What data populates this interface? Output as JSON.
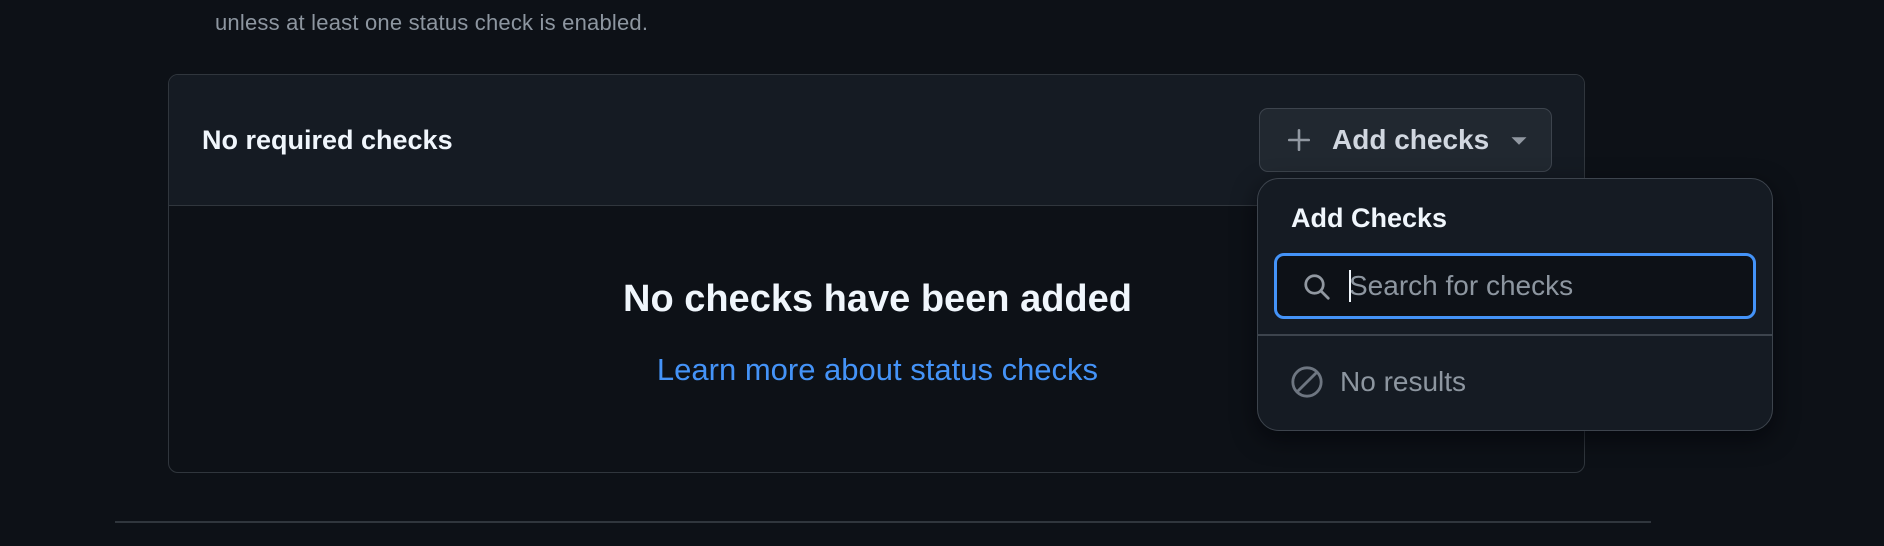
{
  "description": {
    "line": "unless at least one status check is enabled."
  },
  "checks_section": {
    "header_title": "No required checks",
    "add_button_label": "Add checks",
    "empty_title": "No checks have been added",
    "learn_more_link": "Learn more about status checks"
  },
  "dropdown": {
    "title": "Add Checks",
    "search_placeholder": "Search for checks",
    "search_value": "",
    "no_results_text": "No results"
  },
  "colors": {
    "background": "#0d1117",
    "panel_header": "#151b23",
    "border": "#30363d",
    "accent_link": "#4493f8",
    "focus_ring": "#4493f8",
    "muted_text": "#8d96a0"
  },
  "icons": {
    "add_button": "plus-icon",
    "add_button_caret": "triangle-down-icon",
    "search": "search-icon",
    "no_results": "circle-slash-icon"
  }
}
